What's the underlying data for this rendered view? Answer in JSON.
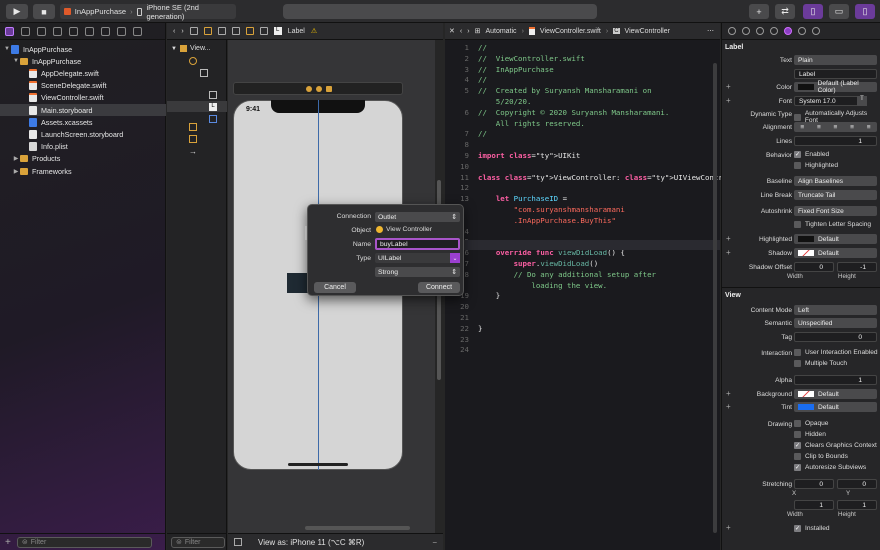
{
  "toolbar": {
    "scheme_target": "InAppPurchase",
    "scheme_device": "iPhone SE (2nd generation)",
    "run_icon": "play-icon",
    "stop_icon": "stop-icon"
  },
  "navigator": {
    "items": [
      {
        "label": "InAppPurchase",
        "kind": "project",
        "depth": 0
      },
      {
        "label": "InAppPurchase",
        "kind": "folder",
        "depth": 1
      },
      {
        "label": "AppDelegate.swift",
        "kind": "swift",
        "depth": 2
      },
      {
        "label": "SceneDelegate.swift",
        "kind": "swift",
        "depth": 2
      },
      {
        "label": "ViewController.swift",
        "kind": "swift",
        "depth": 2
      },
      {
        "label": "Main.storyboard",
        "kind": "storyboard",
        "depth": 2,
        "selected": true
      },
      {
        "label": "Assets.xcassets",
        "kind": "assets",
        "depth": 2
      },
      {
        "label": "LaunchScreen.storyboard",
        "kind": "storyboard",
        "depth": 2
      },
      {
        "label": "Info.plist",
        "kind": "plist",
        "depth": 2
      },
      {
        "label": "Products",
        "kind": "folder",
        "depth": 1
      },
      {
        "label": "Frameworks",
        "kind": "folder",
        "depth": 1
      }
    ],
    "filter_placeholder": "Filter"
  },
  "outline": {
    "item1": "View...",
    "filter_placeholder": "Filter"
  },
  "jumpbar": {
    "label": "Label",
    "warning_icon": "warning-icon"
  },
  "canvas": {
    "time": "9:41",
    "footer": "View as: iPhone 11 (⌥C ⌘R)"
  },
  "connection_popup": {
    "connection_label": "Connection",
    "connection_value": "Outlet",
    "object_label": "Object",
    "object_value": "View Controller",
    "name_label": "Name",
    "name_value": "buyLabel",
    "type_label": "Type",
    "type_value": "UILabel",
    "storage_value": "Strong",
    "cancel": "Cancel",
    "connect": "Connect"
  },
  "editor": {
    "jump_mode": "Automatic",
    "jump_file": "ViewController.swift",
    "jump_class": "ViewController",
    "lines": [
      {
        "n": "1",
        "t": "//",
        "c": "cmt"
      },
      {
        "n": "2",
        "t": "//  ViewController.swift",
        "c": "cmt"
      },
      {
        "n": "3",
        "t": "//  InAppPurchase",
        "c": "cmt"
      },
      {
        "n": "4",
        "t": "//",
        "c": "cmt"
      },
      {
        "n": "5",
        "t": "//  Created by Suryansh Mansharamani on",
        "c": "cmt"
      },
      {
        "n": "",
        "t": "    5/20/20.",
        "c": "cmt"
      },
      {
        "n": "6",
        "t": "//  Copyright © 2020 Suryansh Mansharamani.",
        "c": "cmt"
      },
      {
        "n": "",
        "t": "    All rights reserved.",
        "c": "cmt"
      },
      {
        "n": "7",
        "t": "//",
        "c": "cmt"
      },
      {
        "n": "8",
        "t": "",
        "c": "plain"
      },
      {
        "n": "9",
        "t": "import UIKit",
        "c": "import"
      },
      {
        "n": "10",
        "t": "",
        "c": "plain"
      },
      {
        "n": "11",
        "t": "class ViewController: UIViewController {",
        "c": "class"
      },
      {
        "n": "12",
        "t": "",
        "c": "plain"
      },
      {
        "n": "13",
        "t": "    let PurchaseID =",
        "c": "let"
      },
      {
        "n": "",
        "t": "        \"com.suryanshmansharamani",
        "c": "str"
      },
      {
        "n": "",
        "t": "        .InAppPurchase.BuyThis\"",
        "c": "str"
      },
      {
        "n": "14",
        "t": "",
        "c": "plain"
      },
      {
        "n": "15",
        "t": "",
        "c": "plain"
      },
      {
        "n": "16",
        "t": "    override func viewDidLoad() {",
        "c": "func"
      },
      {
        "n": "17",
        "t": "        super.viewDidLoad()",
        "c": "super"
      },
      {
        "n": "18",
        "t": "        // Do any additional setup after",
        "c": "cmt"
      },
      {
        "n": "",
        "t": "            loading the view.",
        "c": "cmt"
      },
      {
        "n": "19",
        "t": "    }",
        "c": "plain"
      },
      {
        "n": "20",
        "t": "",
        "c": "plain"
      },
      {
        "n": "21",
        "t": "",
        "c": "plain"
      },
      {
        "n": "22",
        "t": "}",
        "c": "plain"
      },
      {
        "n": "23",
        "t": "",
        "c": "plain"
      },
      {
        "n": "24",
        "t": "",
        "c": "plain"
      }
    ]
  },
  "inspector": {
    "label_section": "Label",
    "text_label": "Text",
    "text_value": "Plain",
    "text_content": "Label",
    "color_label": "Color",
    "color_value": "Default (Label Color)",
    "font_label": "Font",
    "font_value": "System 17.0",
    "dyntype_label": "Dynamic Type",
    "dyntype_value": "Automatically Adjusts Font",
    "alignment_label": "Alignment",
    "lines_label": "Lines",
    "lines_value": "1",
    "behavior_label": "Behavior",
    "enabled": "Enabled",
    "highlighted": "Highlighted",
    "baseline_label": "Baseline",
    "baseline_value": "Align Baselines",
    "linebreak_label": "Line Break",
    "linebreak_value": "Truncate Tail",
    "autoshrink_label": "Autoshrink",
    "autoshrink_value": "Fixed Font Size",
    "tighten": "Tighten Letter Spacing",
    "highlighted_label": "Highlighted",
    "highlighted_value": "Default",
    "shadow_label": "Shadow",
    "shadow_value": "Default",
    "shadow_offset_label": "Shadow Offset",
    "shadow_w": "0",
    "shadow_h": "-1",
    "width": "Width",
    "height": "Height",
    "view_section": "View",
    "contentmode_label": "Content Mode",
    "contentmode_value": "Left",
    "semantic_label": "Semantic",
    "semantic_value": "Unspecified",
    "tag_label": "Tag",
    "tag_value": "0",
    "interaction_label": "Interaction",
    "user_interaction": "User Interaction Enabled",
    "multiple_touch": "Multiple Touch",
    "alpha_label": "Alpha",
    "alpha_value": "1",
    "background_label": "Background",
    "background_value": "Default",
    "tint_label": "Tint",
    "tint_value": "Default",
    "drawing_label": "Drawing",
    "opaque": "Opaque",
    "hidden": "Hidden",
    "clears": "Clears Graphics Context",
    "clip": "Clip to Bounds",
    "autoresize": "Autoresize Subviews",
    "stretching_label": "Stretching",
    "sx": "0",
    "sy": "0",
    "x": "X",
    "y": "Y",
    "sw": "1",
    "sh": "1",
    "installed": "Installed"
  }
}
